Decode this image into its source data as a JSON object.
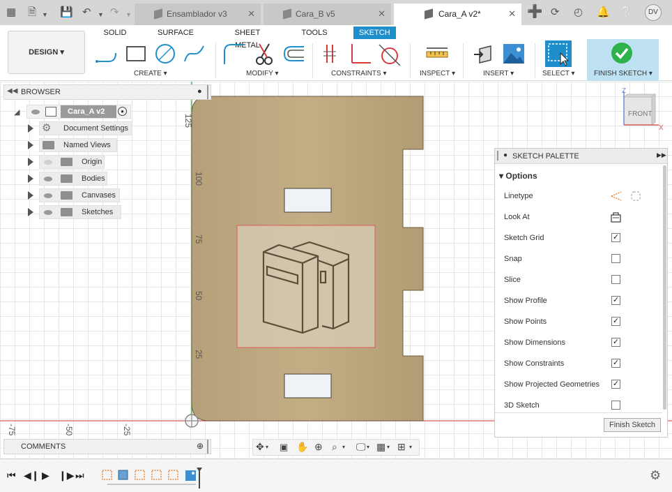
{
  "topbar": {
    "tabs": [
      {
        "label": "Ensamblador v3",
        "active": false
      },
      {
        "label": "Cara_B v5",
        "active": false
      },
      {
        "label": "Cara_A v2*",
        "active": true
      }
    ],
    "user_initials": "DV"
  },
  "toolbar": {
    "mode_tabs": [
      "SOLID",
      "SURFACE",
      "SHEET METAL",
      "TOOLS",
      "SKETCH"
    ],
    "active_mode": "SKETCH",
    "workspace": "DESIGN",
    "groups": {
      "create": "CREATE",
      "modify": "MODIFY",
      "constraints": "CONSTRAINTS",
      "inspect": "INSPECT",
      "insert": "INSERT",
      "select": "SELECT",
      "finish": "FINISH SKETCH"
    }
  },
  "browser": {
    "title": "BROWSER",
    "root": "Cara_A v2",
    "items": [
      "Document Settings",
      "Named Views",
      "Origin",
      "Bodies",
      "Canvases",
      "Sketches"
    ]
  },
  "comments": {
    "title": "COMMENTS"
  },
  "ruler": {
    "vertical": [
      "125",
      "100",
      "75",
      "50",
      "25"
    ],
    "horizontal": [
      "-75",
      "-50",
      "-25"
    ]
  },
  "viewcube": {
    "face": "FRONT",
    "axis_z": "Z",
    "axis_x": "X"
  },
  "palette": {
    "title": "SKETCH PALETTE",
    "section": "Options",
    "options": [
      {
        "label": "Linetype",
        "type": "icons"
      },
      {
        "label": "Look At",
        "type": "icon"
      },
      {
        "label": "Sketch Grid",
        "checked": true
      },
      {
        "label": "Snap",
        "checked": false
      },
      {
        "label": "Slice",
        "checked": false
      },
      {
        "label": "Show Profile",
        "checked": true
      },
      {
        "label": "Show Points",
        "checked": true
      },
      {
        "label": "Show Dimensions",
        "checked": true
      },
      {
        "label": "Show Constraints",
        "checked": true
      },
      {
        "label": "Show Projected Geometries",
        "checked": true
      },
      {
        "label": "3D Sketch",
        "checked": false
      }
    ],
    "finish_button": "Finish Sketch"
  },
  "colors": {
    "accent": "#1f8fcc",
    "wood": "#b9a57d",
    "finish_bg": "#bfe2f3",
    "check_green": "#2fb24c"
  }
}
